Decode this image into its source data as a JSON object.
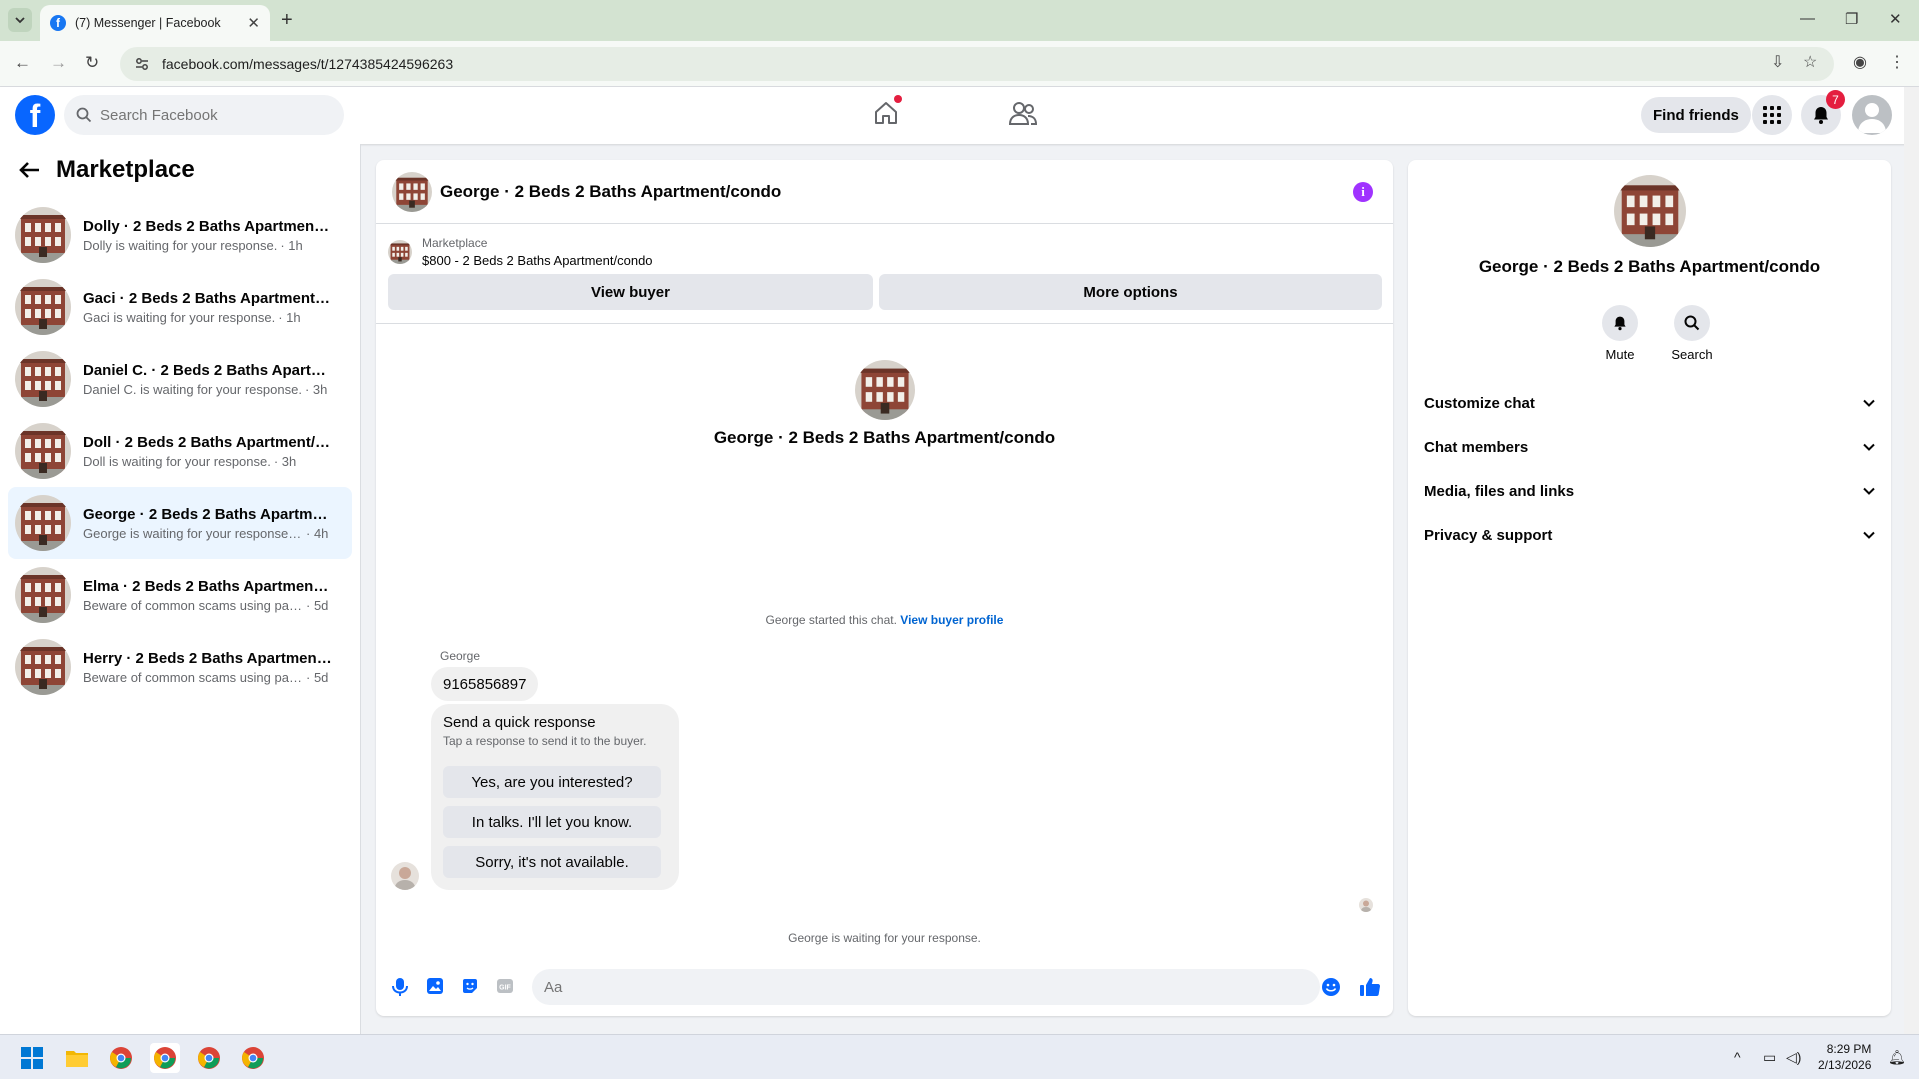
{
  "browser": {
    "tab_title": "(7) Messenger | Facebook",
    "url": "facebook.com/messages/t/1274385424596263"
  },
  "header": {
    "search_placeholder": "Search Facebook",
    "find_friends": "Find friends",
    "notification_count": "7"
  },
  "sidebar": {
    "title": "Marketplace",
    "conversations": [
      {
        "name": "Dolly · 2 Beds 2 Baths Apartment/condo",
        "preview": "Dolly is waiting for your response.",
        "time": "· 1h",
        "selected": false
      },
      {
        "name": "Gaci · 2 Beds 2 Baths Apartment/condo",
        "preview": "Gaci is waiting for your response.",
        "time": "· 1h",
        "selected": false
      },
      {
        "name": "Daniel C. · 2 Beds 2 Baths Apartment/condo",
        "preview": "Daniel C. is waiting for your response.",
        "time": "· 3h",
        "selected": false
      },
      {
        "name": "Doll · 2 Beds 2 Baths Apartment/condo",
        "preview": "Doll is waiting for your response.",
        "time": "· 3h",
        "selected": false
      },
      {
        "name": "George · 2 Beds 2 Baths Apartment/condo",
        "preview": "George is waiting for your response.......",
        "time": "· 4h",
        "selected": true
      },
      {
        "name": "Elma · 2 Beds 2 Baths Apartment/condo",
        "preview": "Beware of common scams using payment apps",
        "time": "· 5d",
        "selected": false
      },
      {
        "name": "Herry · 2 Beds 2 Baths Apartment/condo",
        "preview": "Beware of common scams using payment apps",
        "time": "· 5d",
        "selected": false
      }
    ]
  },
  "chat": {
    "title": "George · 2 Beds 2 Baths Apartment/condo",
    "marketplace_label": "Marketplace",
    "listing": "$800 - 2 Beds 2 Baths Apartment/condo",
    "view_buyer": "View buyer",
    "more_options": "More options",
    "profile_name": "George · 2 Beds 2 Baths Apartment/condo",
    "started_text": "George started this chat.",
    "view_buyer_profile": "View buyer profile",
    "sender": "George",
    "message": "9165856897",
    "quick_title": "Send a quick response",
    "quick_sub": "Tap a response to send it to the buyer.",
    "quick_responses": [
      "Yes, are you interested?",
      "In talks. I'll let you know.",
      "Sorry, it's not available."
    ],
    "waiting_text": "George is waiting for your response.",
    "composer_placeholder": "Aa"
  },
  "details": {
    "name": "George · 2 Beds 2 Baths Apartment/condo",
    "mute": "Mute",
    "search": "Search",
    "sections": [
      "Customize chat",
      "Chat members",
      "Media, files and links",
      "Privacy & support"
    ]
  },
  "taskbar": {
    "time": "8:29 PM",
    "date": "2/13/2026"
  }
}
